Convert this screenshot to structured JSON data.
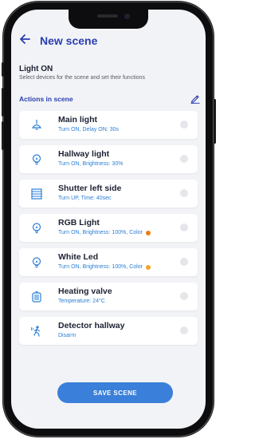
{
  "header": {
    "back_icon": "arrow-left-icon",
    "title": "New scene"
  },
  "scene": {
    "name": "Light ON",
    "subtitle": "Select devices for the scene and set their functions"
  },
  "actions": {
    "label": "Actions in scene",
    "edit_icon": "pencil-edit-icon",
    "items": [
      {
        "name": "main-light",
        "icon": "ceiling-lamp-icon",
        "title": "Main light",
        "subtitle": "Turn ON, Delay ON: 30s"
      },
      {
        "name": "hallway-light",
        "icon": "bulb-icon",
        "title": "Hallway light",
        "subtitle": "Turn ON, Brightness: 30%"
      },
      {
        "name": "shutter-left-side",
        "icon": "shutter-icon",
        "title": "Shutter left side",
        "subtitle": "Turn UP, Time: 40sec"
      },
      {
        "name": "rgb-light",
        "icon": "bulb-icon",
        "title": "RGB Light",
        "subtitle": "Turn ON, Brightness: 100%, Color",
        "color_dot": "#f07d1a"
      },
      {
        "name": "white-led",
        "icon": "bulb-icon",
        "title": "White Led",
        "subtitle": "Turn ON, Brightness: 100%, Color",
        "color_dot": "#f5a623"
      },
      {
        "name": "heating-valve",
        "icon": "radiator-icon",
        "title": "Heating valve",
        "subtitle": "Temperature: 24°C"
      },
      {
        "name": "detector-hallway",
        "icon": "motion-detector-icon",
        "title": "Detector hallway",
        "subtitle": "Disarm"
      }
    ]
  },
  "footer": {
    "save_label": "SAVE SCENE"
  },
  "colors": {
    "accent": "#2a3eb1",
    "subtitle_blue": "#2b7fd6",
    "button": "#3a7fd9",
    "screen_bg": "#f2f3f6"
  }
}
